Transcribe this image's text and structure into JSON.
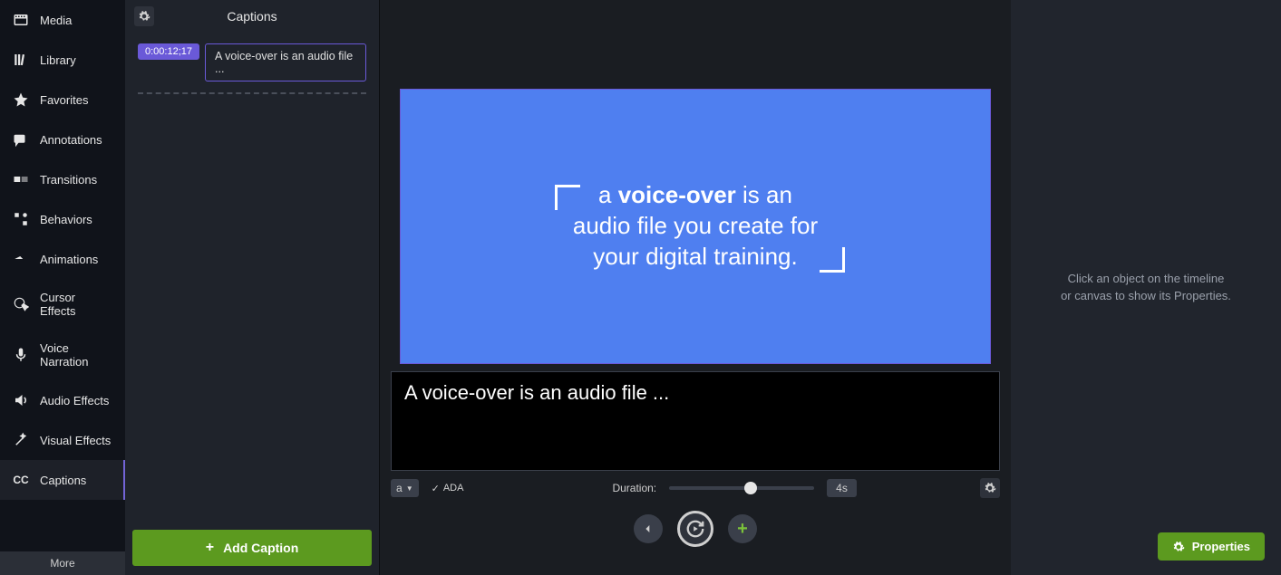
{
  "sidebar": {
    "items": [
      {
        "label": "Media"
      },
      {
        "label": "Library"
      },
      {
        "label": "Favorites"
      },
      {
        "label": "Annotations"
      },
      {
        "label": "Transitions"
      },
      {
        "label": "Behaviors"
      },
      {
        "label": "Animations"
      },
      {
        "label": "Cursor Effects"
      },
      {
        "label": "Voice Narration"
      },
      {
        "label": "Audio Effects"
      },
      {
        "label": "Visual Effects"
      },
      {
        "label": "Captions"
      }
    ],
    "more_label": "More"
  },
  "caption_panel": {
    "title": "Captions",
    "items": [
      {
        "time": "0:00:12;17",
        "text": "A voice-over is an audio file ..."
      }
    ],
    "add_button": "Add Caption"
  },
  "canvas": {
    "line1_a": "a ",
    "line1_b": "voice-over",
    "line1_c": " is an",
    "line2": "audio file you create for",
    "line3": "your digital training."
  },
  "editor": {
    "text": "A voice-over is an audio file ...",
    "font_glyph": "a",
    "ada_label": "ADA",
    "duration_label": "Duration:",
    "duration_value": "4s"
  },
  "right": {
    "hint_line1": "Click an object on the timeline",
    "hint_line2": "or canvas to show its Properties.",
    "properties_button": "Properties"
  }
}
